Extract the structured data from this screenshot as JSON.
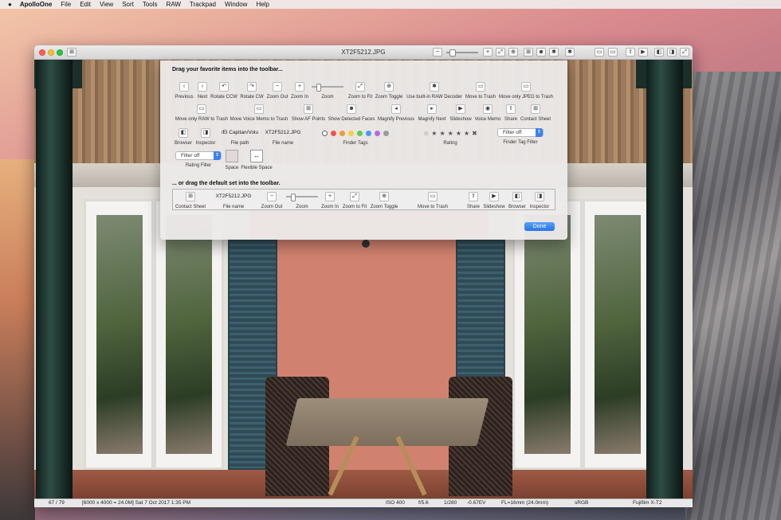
{
  "menubar": {
    "apple": "",
    "app_name": "ApolloOne",
    "items": [
      "File",
      "Edit",
      "View",
      "Sort",
      "Tools",
      "RAW",
      "Trackpad",
      "Window",
      "Help"
    ]
  },
  "window": {
    "title": "XT2F5212.JPG",
    "toolbar_icons": [
      "sidebar-icon",
      "zoom-out-icon",
      "zoom-slider",
      "zoom-in-icon",
      "zoom-to-fit-icon",
      "zoom-toggle-icon",
      "af-points-icon",
      "detected-faces-icon",
      "raw-decoder-icon",
      "move-to-trash-icon",
      "move-jpeg-to-trash-icon",
      "share-icon",
      "slideshow-icon",
      "browser-icon",
      "inspector-icon"
    ]
  },
  "sheet": {
    "heading": "Drag your favorite items into the toolbar...",
    "default_heading": "... or drag the default set into the toolbar.",
    "row1": [
      {
        "label": "Previous",
        "icon": "chevron-left-icon",
        "glyph": "‹"
      },
      {
        "label": "Next",
        "icon": "chevron-right-icon",
        "glyph": "›"
      },
      {
        "label": "Rotate CCW",
        "icon": "rotate-ccw-icon",
        "glyph": "↶"
      },
      {
        "label": "Rotate CW",
        "icon": "rotate-cw-icon",
        "glyph": "↷"
      },
      {
        "label": "Zoom Out",
        "icon": "zoom-out-icon",
        "glyph": "−"
      },
      {
        "label": "Zoom In",
        "icon": "zoom-in-icon",
        "glyph": "+"
      },
      {
        "label": "Zoom",
        "icon": "zoom-slider-icon",
        "glyph": ""
      },
      {
        "label": "Zoom to Fit",
        "icon": "zoom-to-fit-icon",
        "glyph": "⤢"
      },
      {
        "label": "Zoom Toggle",
        "icon": "zoom-toggle-icon",
        "glyph": "⊕"
      },
      {
        "label": "Use built-in RAW Decoder",
        "icon": "gear-icon",
        "glyph": "✱"
      },
      {
        "label": "Move to Trash",
        "icon": "trash-icon",
        "glyph": "▭"
      },
      {
        "label": "Move only JPEG to Trash",
        "icon": "trash-jpeg-icon",
        "glyph": "▭"
      }
    ],
    "row2": [
      {
        "label": "Move only RAW to Trash",
        "icon": "trash-raw-icon",
        "glyph": "▭"
      },
      {
        "label": "Move Voice Memo to Trash",
        "icon": "trash-voice-memo-icon",
        "glyph": "▭"
      },
      {
        "label": "Show AF Points",
        "icon": "af-points-icon",
        "glyph": "⊞"
      },
      {
        "label": "Show Detected Faces",
        "icon": "face-icon",
        "glyph": "☻"
      },
      {
        "label": "Magnify Previous",
        "icon": "magnify-previous-icon",
        "glyph": "◂"
      },
      {
        "label": "Magnify Next",
        "icon": "magnify-next-icon",
        "glyph": "▸"
      },
      {
        "label": "Slideshow",
        "icon": "slideshow-icon",
        "glyph": "▶"
      },
      {
        "label": "Voice Memo",
        "icon": "voice-memo-icon",
        "glyph": "◉"
      },
      {
        "label": "Share",
        "icon": "share-icon",
        "glyph": "⇧"
      },
      {
        "label": "Contact Sheet",
        "icon": "contact-sheet-icon",
        "glyph": "⊞"
      }
    ],
    "row3": {
      "browser": "Browser",
      "inspector": "Inspector",
      "file_path_value": "/El Capitan/Volu",
      "file_path_label": "File path",
      "file_name_value": "XT2F5212.JPG",
      "file_name_label": "File name",
      "finder_tags_label": "Finder Tags",
      "tag_colors": [
        "#ffffff",
        "#f0544a",
        "#f39a33",
        "#f5cf3c",
        "#5ccb4f",
        "#3f9ff0",
        "#b968e0",
        "#9a9a9a"
      ],
      "rating_label": "Rating",
      "finder_tag_filter_label": "Finder Tag Filter",
      "finder_tag_filter_value": "Filter off"
    },
    "row4": {
      "rating_filter_value": "Filter off",
      "rating_filter_label": "Rating Filter",
      "space_label": "Space",
      "flexible_space_label": "Flexible Space"
    },
    "default_set": [
      {
        "label": "Contact Sheet",
        "icon": "contact-sheet-icon",
        "glyph": "⊞"
      },
      {
        "label": "File name",
        "icon": "",
        "glyph": ""
      },
      {
        "label": "Zoom Out",
        "icon": "zoom-out-icon",
        "glyph": "−"
      },
      {
        "label": "Zoom",
        "icon": "zoom-slider-icon",
        "glyph": ""
      },
      {
        "label": "Zoom In",
        "icon": "zoom-in-icon",
        "glyph": "+"
      },
      {
        "label": "Zoom to Fit",
        "icon": "zoom-to-fit-icon",
        "glyph": "⤢"
      },
      {
        "label": "Zoom Toggle",
        "icon": "zoom-toggle-icon",
        "glyph": "⊕"
      },
      {
        "label": "Move to Trash",
        "icon": "trash-icon",
        "glyph": "▭"
      },
      {
        "label": "Share",
        "icon": "share-icon",
        "glyph": "⇧"
      },
      {
        "label": "Slideshow",
        "icon": "slideshow-icon",
        "glyph": "▶"
      },
      {
        "label": "Browser",
        "icon": "browser-icon",
        "glyph": "◧"
      },
      {
        "label": "Inspector",
        "icon": "inspector-icon",
        "glyph": "◨"
      }
    ],
    "default_file_name_value": "XT2F5212.JPG",
    "done_label": "Done"
  },
  "statusbar": {
    "index": "67 / 79",
    "info": "[6000 x 4000 = 24.0M] Sat 7 Oct 2017  1:35 PM",
    "iso": "ISO 400",
    "aperture": "f/5.6",
    "shutter": "1/280",
    "ev": "-0.67EV",
    "focal": "FL=16mm (24.0mm)",
    "color_space": "sRGB",
    "camera": "Fujifilm X-T2"
  }
}
